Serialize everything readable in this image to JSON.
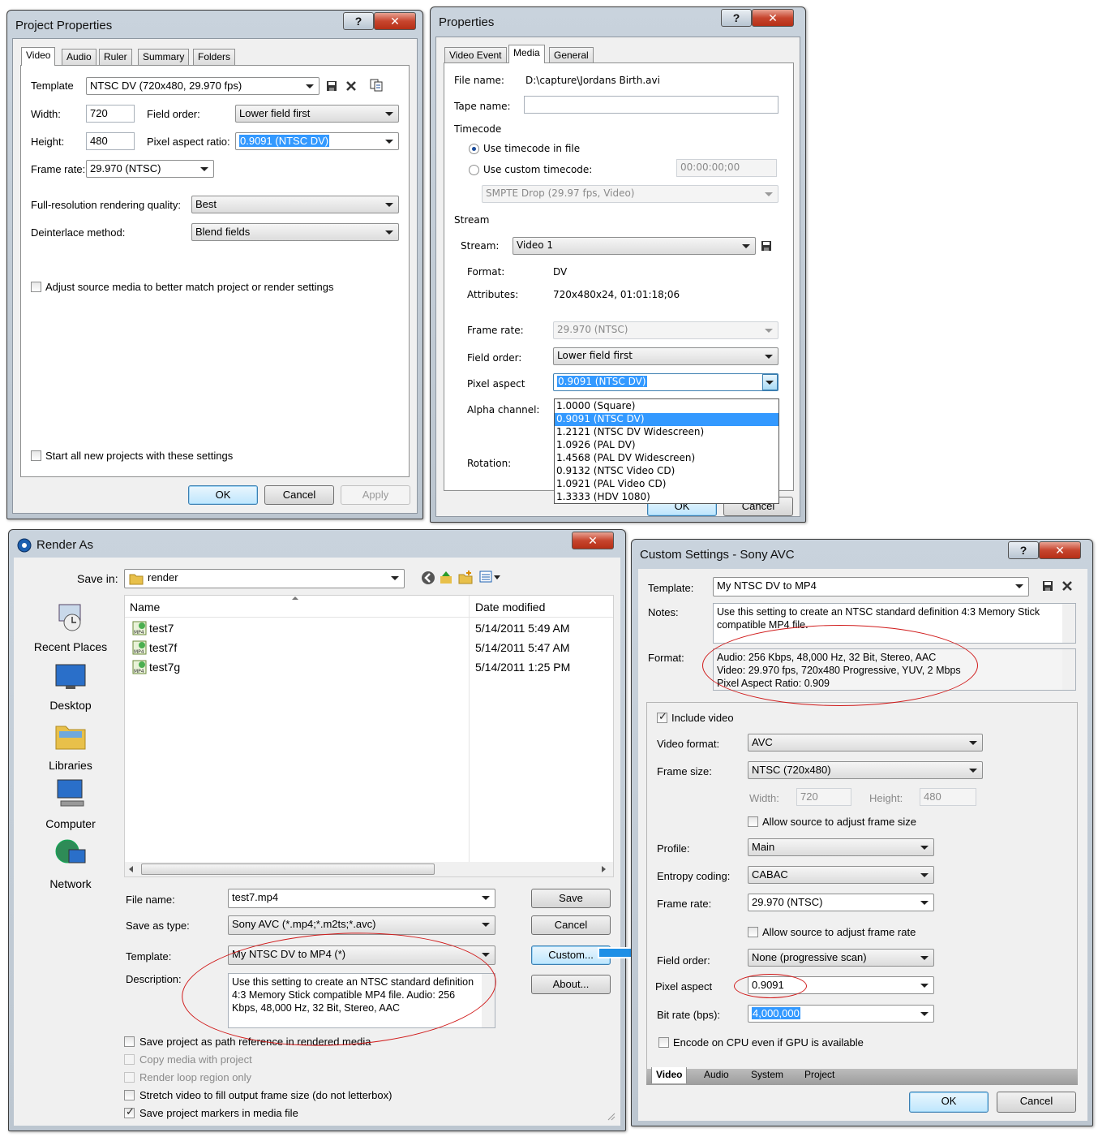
{
  "project_properties": {
    "title": "Project Properties",
    "tabs": [
      "Video",
      "Audio",
      "Ruler",
      "Summary",
      "Folders"
    ],
    "template_label": "Template",
    "template_value": "NTSC DV (720x480, 29.970 fps)",
    "width_label": "Width:",
    "width_value": "720",
    "height_label": "Height:",
    "height_value": "480",
    "field_order_label": "Field order:",
    "field_order_value": "Lower field first",
    "pixel_aspect_label": "Pixel aspect ratio:",
    "pixel_aspect_value": "0.9091 (NTSC DV)",
    "frame_rate_label": "Frame rate:",
    "frame_rate_value": "29.970 (NTSC)",
    "quality_label": "Full-resolution rendering quality:",
    "quality_value": "Best",
    "deinterlace_label": "Deinterlace method:",
    "deinterlace_value": "Blend fields",
    "adjust_label": "Adjust source media to better match project or render settings",
    "start_new_label": "Start all new projects with these settings",
    "ok": "OK",
    "cancel": "Cancel",
    "apply": "Apply"
  },
  "properties": {
    "title": "Properties",
    "tabs": [
      "Video Event",
      "Media",
      "General"
    ],
    "file_name_label": "File name:",
    "file_name_value": "D:\\capture\\Jordans Birth.avi",
    "tape_name_label": "Tape name:",
    "timecode_label": "Timecode",
    "use_timecode_label": "Use timecode in file",
    "use_custom_label": "Use custom timecode:",
    "custom_timecode_value": "00:00:00;00",
    "smpte_value": "SMPTE Drop (29.97 fps, Video)",
    "stream_section": "Stream",
    "stream_label": "Stream:",
    "stream_value": "Video 1",
    "format_label": "Format:",
    "format_value": "DV",
    "attributes_label": "Attributes:",
    "attributes_value": "720x480x24, 01:01:18;06",
    "frame_rate_label": "Frame rate:",
    "frame_rate_value": "29.970 (NTSC)",
    "field_order_label": "Field order:",
    "field_order_value": "Lower field first",
    "pixel_aspect_label": "Pixel aspect",
    "pixel_aspect_value": "0.9091 (NTSC DV)",
    "alpha_label": "Alpha channel:",
    "rotation_label": "Rotation:",
    "dropdown_options": [
      "1.0000 (Square)",
      "0.9091 (NTSC DV)",
      "1.2121 (NTSC DV Widescreen)",
      "1.0926 (PAL DV)",
      "1.4568 (PAL DV Widescreen)",
      "0.9132 (NTSC Video CD)",
      "1.0921 (PAL Video CD)",
      "1.3333 (HDV 1080)"
    ],
    "ok": "OK",
    "cancel": "Cancel"
  },
  "render_as": {
    "title": "Render As",
    "save_in_label": "Save in:",
    "save_in_value": "render",
    "places": [
      "Recent Places",
      "Desktop",
      "Libraries",
      "Computer",
      "Network"
    ],
    "col_name": "Name",
    "col_date": "Date modified",
    "files": [
      {
        "name": "test7",
        "date": "5/14/2011 5:49 AM"
      },
      {
        "name": "test7f",
        "date": "5/14/2011 5:47 AM"
      },
      {
        "name": "test7g",
        "date": "5/14/2011 1:25 PM"
      }
    ],
    "file_name_label": "File name:",
    "file_name_value": "test7.mp4",
    "save_type_label": "Save as type:",
    "save_type_value": "Sony AVC (*.mp4;*.m2ts;*.avc)",
    "template_label": "Template:",
    "template_value": "My NTSC DV to MP4 (*)",
    "description_label": "Description:",
    "description_value": "Use this setting to create an NTSC standard definition 4:3 Memory Stick compatible MP4 file. Audio: 256 Kbps, 48,000 Hz, 32 Bit, Stereo, AAC",
    "save_btn": "Save",
    "cancel_btn": "Cancel",
    "custom_btn": "Custom...",
    "about_btn": "About...",
    "options": [
      {
        "label": "Save project as path reference in rendered media",
        "checked": false,
        "enabled": true
      },
      {
        "label": "Copy media with project",
        "checked": false,
        "enabled": false
      },
      {
        "label": "Render loop region only",
        "checked": false,
        "enabled": false
      },
      {
        "label": "Stretch video to fill output frame size (do not letterbox)",
        "checked": false,
        "enabled": true
      },
      {
        "label": "Save project markers in media file",
        "checked": true,
        "enabled": true
      }
    ]
  },
  "custom_settings": {
    "title": "Custom Settings - Sony AVC",
    "template_label": "Template:",
    "template_value": "My NTSC DV to MP4",
    "notes_label": "Notes:",
    "notes_value": "Use this setting to create an NTSC standard definition 4:3 Memory Stick compatible MP4 file.",
    "format_label": "Format:",
    "format_lines": [
      "Audio: 256 Kbps, 48,000 Hz, 32 Bit, Stereo, AAC",
      "Video: 29.970 fps, 720x480 Progressive, YUV, 2 Mbps",
      "Pixel Aspect Ratio: 0.909"
    ],
    "include_video_label": "Include video",
    "video_format_label": "Video format:",
    "video_format_value": "AVC",
    "frame_size_label": "Frame size:",
    "frame_size_value": "NTSC (720x480)",
    "width_label": "Width:",
    "width_value": "720",
    "height_label": "Height:",
    "height_value": "480",
    "allow_frame_size_label": "Allow source to adjust frame size",
    "profile_label": "Profile:",
    "profile_value": "Main",
    "entropy_label": "Entropy coding:",
    "entropy_value": "CABAC",
    "frame_rate_label": "Frame rate:",
    "frame_rate_value": "29.970 (NTSC)",
    "allow_frame_rate_label": "Allow source to adjust frame rate",
    "field_order_label": "Field order:",
    "field_order_value": "None (progressive scan)",
    "pixel_aspect_label": "Pixel aspect",
    "pixel_aspect_value": "0.9091",
    "bit_rate_label": "Bit rate (bps):",
    "bit_rate_value": "4,000,000",
    "encode_cpu_label": "Encode on CPU even if GPU is available",
    "bottom_tabs": [
      "Video",
      "Audio",
      "System",
      "Project"
    ],
    "ok": "OK",
    "cancel": "Cancel"
  },
  "colors": {
    "annotation_red": "#d01a1a",
    "arrow_blue": "#1e8fe6",
    "selection": "#3399ff"
  }
}
